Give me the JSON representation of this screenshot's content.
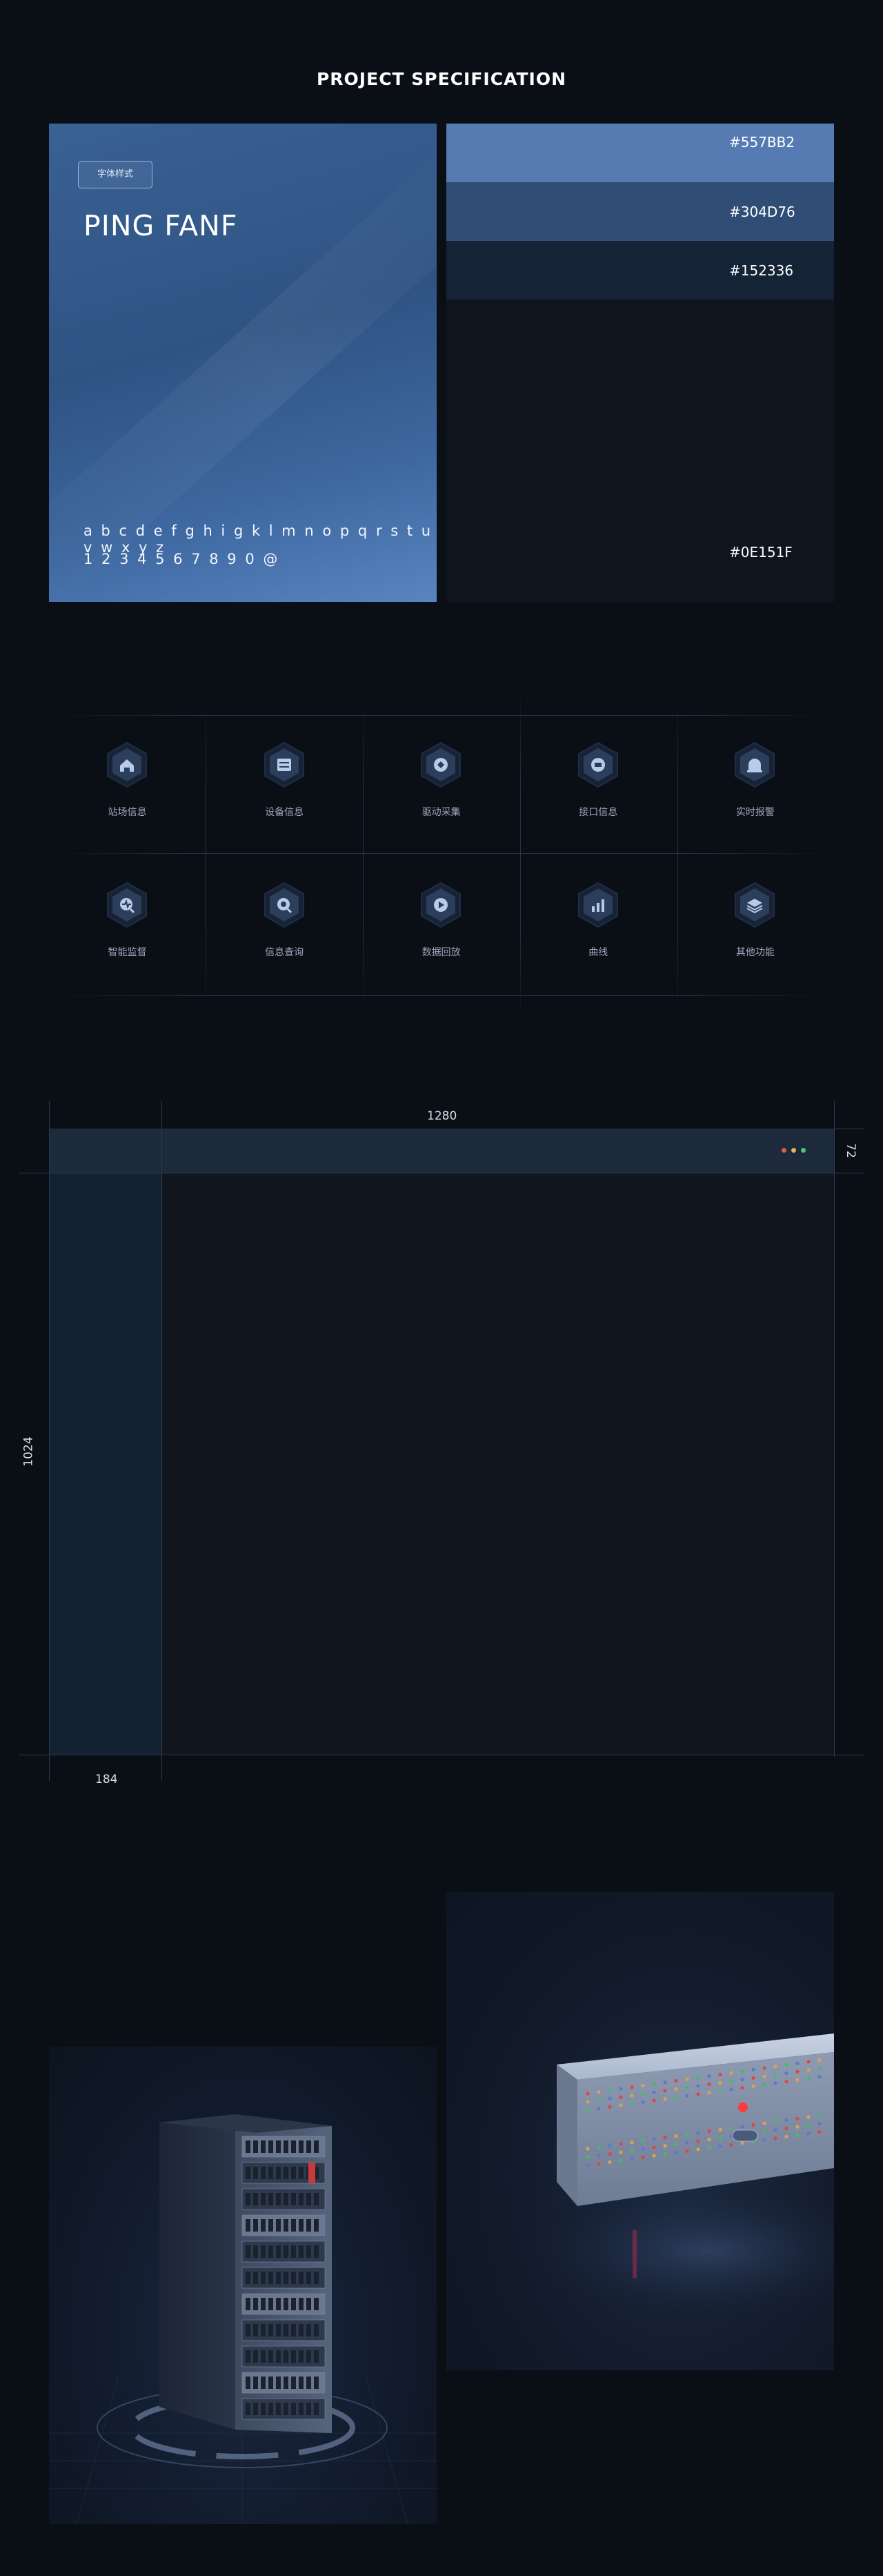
{
  "page_title": "PROJECT SPECIFICATION",
  "typography": {
    "tag": "字体样式",
    "font_name": "PING FANF",
    "alphabet": "a b c d e f g h i g k l m n o p q r s t u v w x y z",
    "digits": "1 2 3 4 5 6 7 8 9 0 @"
  },
  "colors": [
    {
      "hex": "#557BB2",
      "label": "#557BB2"
    },
    {
      "hex": "#304D76",
      "label": "#304D76"
    },
    {
      "hex": "#152336",
      "label": "#152336"
    },
    {
      "hex": "#0E151F",
      "label": "#0E151F"
    }
  ],
  "icons": [
    {
      "label": "站场信息",
      "icon": "home-icon"
    },
    {
      "label": "设备信息",
      "icon": "device-info-icon"
    },
    {
      "label": "驱动采集",
      "icon": "driver-collect-icon"
    },
    {
      "label": "接口信息",
      "icon": "interface-icon"
    },
    {
      "label": "实时报警",
      "icon": "alarm-icon"
    },
    {
      "label": "智能监督",
      "icon": "monitor-icon"
    },
    {
      "label": "信息查询",
      "icon": "search-icon"
    },
    {
      "label": "数据回放",
      "icon": "playback-icon"
    },
    {
      "label": "曲线",
      "icon": "chart-icon"
    },
    {
      "label": "其他功能",
      "icon": "layers-icon"
    }
  ],
  "layout_spec": {
    "width_label": "1280",
    "height_label": "1024",
    "header_height_label": "72",
    "sidebar_width_label": "184",
    "dot_colors": [
      "#e05a4e",
      "#e0b44e",
      "#4ec47a"
    ]
  }
}
